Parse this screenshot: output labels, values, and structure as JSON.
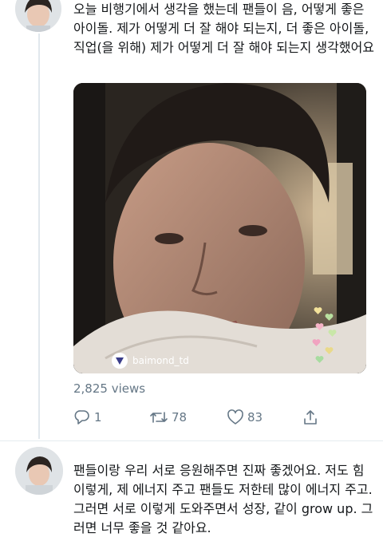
{
  "tweet1": {
    "text": "오늘 비행기에서 생각을 했는데 팬들이 음, 어떻게 좋은 아이돌. 제가 어떻게 더 잘 해야 되는지, 더 좋은 아이돌, 직업(을 위해) 제가 어떻게 더 잘 해야 되는지 생각했어요",
    "media": {
      "watermark_handle": "baimond_td",
      "watermark_icon": "vlive-logo-icon",
      "overlay_icon": "floating-hearts-icon"
    },
    "views": "2,825 views",
    "actions": {
      "reply_count": "1",
      "retweet_count": "78",
      "like_count": "83",
      "reply_icon": "reply-icon",
      "retweet_icon": "retweet-icon",
      "like_icon": "heart-icon",
      "share_icon": "share-icon"
    }
  },
  "tweet2": {
    "text": "팬들이랑 우리 서로 응원해주면 진짜 좋겠어요. 저도 힘 이렇게, 제 에너지 주고 팬들도 저한테 많이 에너지 주고. 그러면 서로 이렇게 도와주면서 성장, 같이 grow up. 그러면 너무 좋을 것 같아요."
  },
  "colors": {
    "text_primary": "#14171a",
    "text_secondary": "#657786",
    "divider": "#e6ecf0",
    "thread_line": "#e1e8ed"
  }
}
